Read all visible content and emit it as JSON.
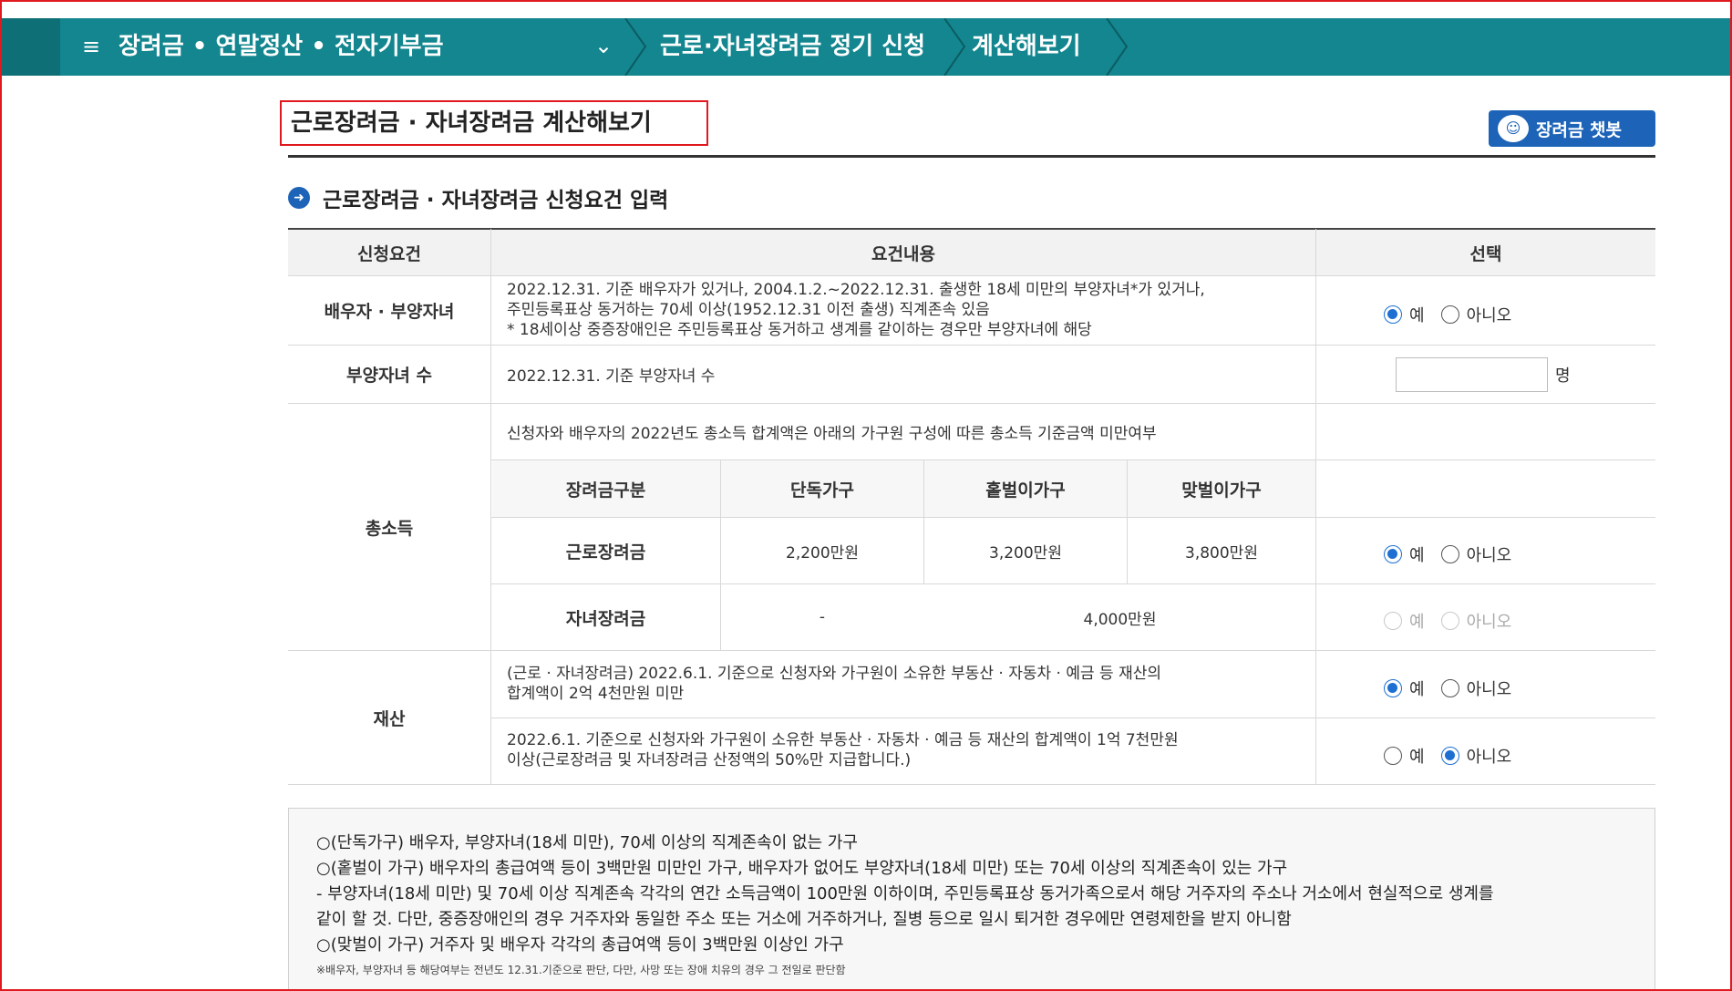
{
  "nav": {
    "crumb1": "장려금 • 연말정산 • 전자기부금",
    "crumb2": "근로·자녀장려금 정기 신청",
    "crumb3": "계산해보기"
  },
  "page": {
    "title": "근로장려금 · 자녀장려금 계산해보기",
    "chatbot_label": "장려금 챗봇",
    "section_heading": "근로장려금 · 자녀장려금 신청요건 입력"
  },
  "table": {
    "headers": [
      "신청요건",
      "요건내용",
      "선택"
    ],
    "spouse": {
      "label": "배우자 · 부양자녀",
      "line1": "2022.12.31. 기준 배우자가 있거나, 2004.1.2.~2022.12.31. 출생한 18세 미만의 부양자녀*가 있거나,",
      "line2": "주민등록표상 동거하는 70세 이상(1952.12.31 이전 출생) 직계존속 있음",
      "line3": "* 18세이상 중증장애인은 주민등록표상 동거하고 생계를 같이하는 경우만 부양자녀에 해당"
    },
    "children": {
      "label": "부양자녀 수",
      "text": "2022.12.31. 기준 부양자녀 수",
      "input_value": "",
      "unit": "명"
    },
    "income": {
      "label": "총소득",
      "desc": "신청자와 배우자의 2022년도 총소득 합계액은 아래의 가구원 구성에 따른 총소득 기준금액 미만여부",
      "sub_headers": [
        "장려금구분",
        "단독가구",
        "홑벌이가구",
        "맞벌이가구"
      ],
      "work_label": "근로장려금",
      "work_values": [
        "2,200만원",
        "3,200만원",
        "3,800만원"
      ],
      "child_label": "자녀장려금",
      "child_single": "-",
      "child_combined": "4,000만원"
    },
    "assets": {
      "label": "재산",
      "row1_line1": "(근로 · 자녀장려금) 2022.6.1. 기준으로 신청자와 가구원이 소유한 부동산 · 자동차 · 예금 등 재산의",
      "row1_line2": "합계액이 2억 4천만원 미만",
      "row2_line1": "2022.6.1. 기준으로 신청자와 가구원이 소유한 부동산 · 자동차 · 예금 등 재산의 합계액이 1억 7천만원",
      "row2_line2": "이상(근로장려금 및 자녀장려금 산정액의 50%만 지급합니다.)"
    },
    "radio": {
      "yes": "예",
      "no": "아니오"
    }
  },
  "notes": {
    "line1": "○(단독가구) 배우자, 부양자녀(18세 미만), 70세 이상의 직계존속이 없는 가구",
    "line2": "○(홑벌이 가구) 배우자의 총급여액 등이 3백만원 미만인 가구, 배우자가 없어도 부양자녀(18세 미만) 또는 70세 이상의 직계존속이 있는 가구",
    "line3": "- 부양자녀(18세 미만) 및 70세 이상 직계존속 각각의 연간 소득금액이 100만원 이하이며, 주민등록표상 동거가족으로서 해당 거주자의 주소나 거소에서 현실적으로 생계를",
    "line4": "같이 할 것. 다만, 중증장애인의 경우 거주자와 동일한 주소 또는 거소에 거주하거나, 질병 등으로 일시 퇴거한 경우에만 연령제한을 받지 아니함",
    "line5": "○(맞벌이 가구) 거주자 및 배우자 각각의 총급여액 등이 3백만원 이상인 가구",
    "small": "※배우자, 부양자녀 등 해당여부는 전년도 12.31.기준으로 판단, 다만, 사망 또는 장애 치유의 경우 그 전일로 판단함"
  }
}
